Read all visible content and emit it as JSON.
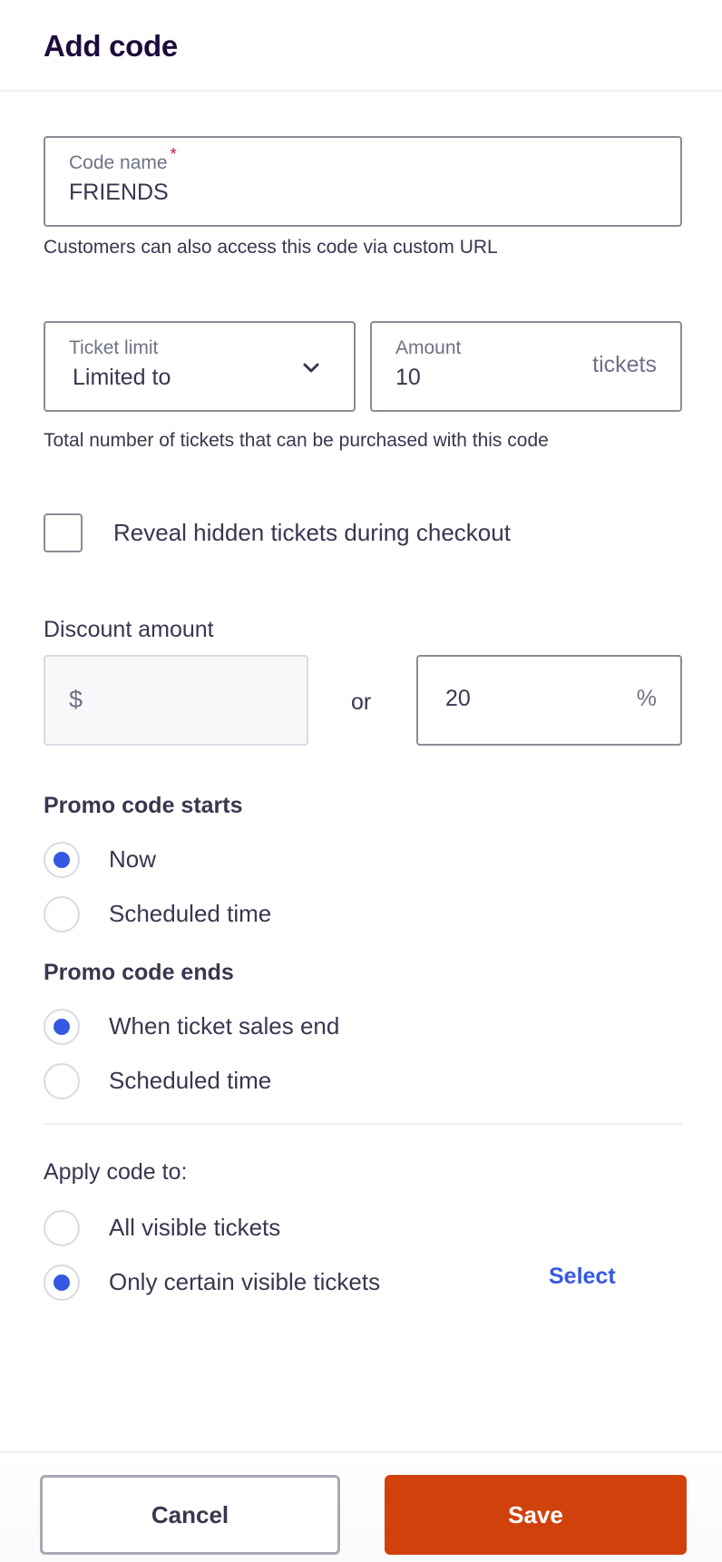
{
  "header": {
    "title": "Add code"
  },
  "code_name": {
    "label": "Code name",
    "required_mark": "*",
    "value": "FRIENDS",
    "help": "Customers can also access this code via custom URL"
  },
  "ticket_limit": {
    "label": "Ticket limit",
    "selected": "Limited to",
    "icon": "chevron-down-icon"
  },
  "amount": {
    "label": "Amount",
    "value": "10",
    "suffix": "tickets",
    "help": "Total number of tickets that can be purchased with this code"
  },
  "reveal_hidden": {
    "label": "Reveal hidden tickets during checkout",
    "checked": false
  },
  "discount": {
    "label": "Discount amount",
    "currency_symbol": "$",
    "currency_value": "",
    "or_label": "or",
    "percent_value": "20",
    "percent_symbol": "%"
  },
  "starts": {
    "title": "Promo code starts",
    "options": [
      {
        "label": "Now",
        "checked": true
      },
      {
        "label": "Scheduled time",
        "checked": false
      }
    ]
  },
  "ends": {
    "title": "Promo code ends",
    "options": [
      {
        "label": "When ticket sales end",
        "checked": true
      },
      {
        "label": "Scheduled time",
        "checked": false
      }
    ]
  },
  "apply": {
    "title": "Apply code to:",
    "options": [
      {
        "label": "All visible tickets",
        "checked": false
      },
      {
        "label": "Only certain visible tickets",
        "checked": true
      }
    ],
    "select_link": "Select"
  },
  "footer": {
    "cancel_label": "Cancel",
    "save_label": "Save"
  },
  "colors": {
    "accent": "#3659e3",
    "primary_button": "#d1410c",
    "title": "#1e0a3c",
    "text": "#39364f",
    "required": "#c5162e"
  }
}
